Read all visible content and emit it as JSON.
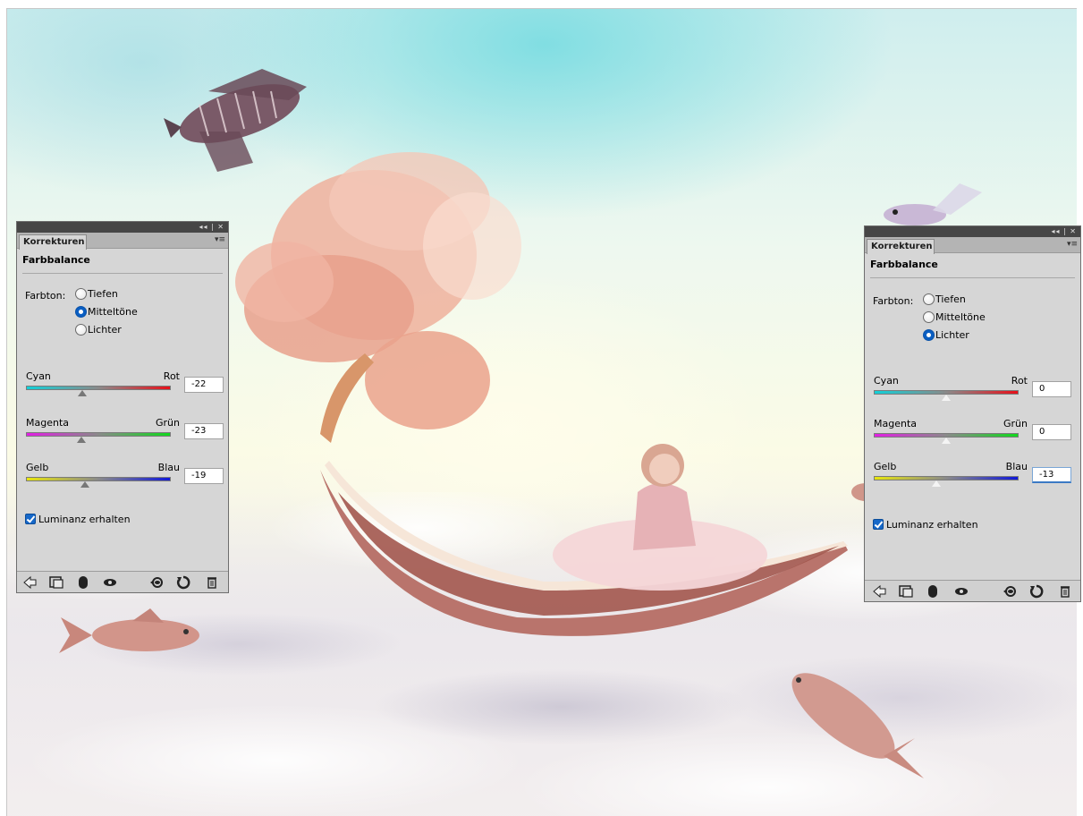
{
  "left_panel": {
    "tab_label": "Korrekturen",
    "title": "Farbbalance",
    "tone_label": "Farbton:",
    "tones": [
      {
        "label": "Tiefen",
        "selected": false
      },
      {
        "label": "Mitteltöne",
        "selected": true
      },
      {
        "label": "Lichter",
        "selected": false
      }
    ],
    "sliders": [
      {
        "left": "Cyan",
        "right": "Rot",
        "value": "-22",
        "position": -22
      },
      {
        "left": "Magenta",
        "right": "Grün",
        "value": "-23",
        "position": -23
      },
      {
        "left": "Gelb",
        "right": "Blau",
        "value": "-19",
        "position": -19
      }
    ],
    "preserve_luminosity": {
      "label": "Luminanz erhalten",
      "checked": true
    }
  },
  "right_panel": {
    "tab_label": "Korrekturen",
    "title": "Farbbalance",
    "tone_label": "Farbton:",
    "tones": [
      {
        "label": "Tiefen",
        "selected": false
      },
      {
        "label": "Mitteltöne",
        "selected": false
      },
      {
        "label": "Lichter",
        "selected": true
      }
    ],
    "sliders": [
      {
        "left": "Cyan",
        "right": "Rot",
        "value": "0",
        "position": 0
      },
      {
        "left": "Magenta",
        "right": "Grün",
        "value": "0",
        "position": 0
      },
      {
        "left": "Gelb",
        "right": "Blau",
        "value": "-13",
        "position": -13
      }
    ],
    "preserve_luminosity": {
      "label": "Luminanz erhalten",
      "checked": true
    }
  },
  "titlebar_controls": "◂◂ | ✕",
  "panel_menu_icon": "▾≡",
  "footer_icons": [
    "back-arrow-icon",
    "clip-to-layer-icon",
    "layer-mask-icon",
    "visibility-eye-icon",
    "view-previous-state-icon",
    "reset-icon",
    "trash-icon"
  ],
  "colors": {
    "accent": "#0a5ec2",
    "panel_bg": "#d6d6d6",
    "titlebar": "#464646"
  }
}
